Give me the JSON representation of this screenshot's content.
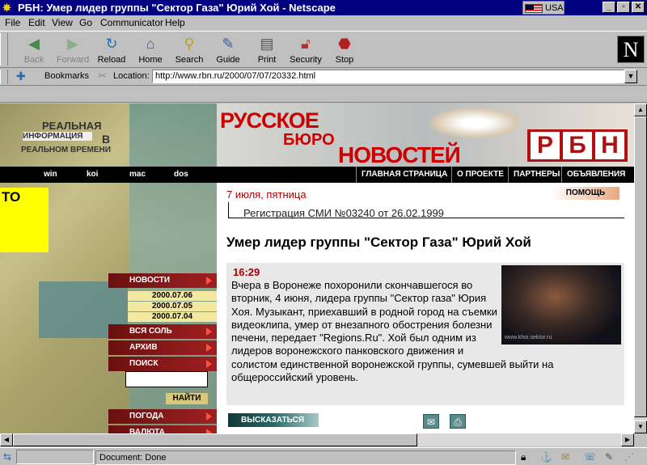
{
  "window": {
    "title": "РБН: Умер лидер группы \"Сектор Газа\" Юрий Хой - Netscape",
    "lang_indicator": "USA"
  },
  "menu": [
    "File",
    "Edit",
    "View",
    "Go",
    "Communicator",
    "Help"
  ],
  "toolbar": {
    "back": "Back",
    "forward": "Forward",
    "reload": "Reload",
    "home": "Home",
    "search": "Search",
    "guide": "Guide",
    "print": "Print",
    "security": "Security",
    "stop": "Stop"
  },
  "location": {
    "bookmarks_label": "Bookmarks",
    "location_label": "Location:",
    "url": "http://www.rbn.ru/2000/07/07/20332.html"
  },
  "site": {
    "realtime": {
      "line1": "РЕАЛЬНАЯ",
      "line2": "ИНФОРМАЦИЯ",
      "line3": "В",
      "line4": "РЕАЛЬНОМ ВРЕМЕНИ"
    },
    "encodings": [
      "win",
      "koi",
      "mac",
      "dos"
    ],
    "yellow_text": "ТО",
    "logo": {
      "line1": "РУССКОЕ",
      "line2": "БЮРО",
      "line3": "НОВОСТЕЙ",
      "letters": [
        "Р",
        "Б",
        "Н"
      ]
    },
    "nav": [
      "ГЛАВНАЯ СТРАНИЦА",
      "О ПРОЕКТЕ",
      "ПАРТНЕРЫ",
      "ОБЪЯВЛЕНИЯ"
    ],
    "date": "7 июля, пятница",
    "help": "ПОМОЩЬ",
    "registration": "Регистрация СМИ №03240 от 26.02.1999",
    "sidebar": {
      "news": "НОВОСТИ",
      "dates": [
        "2000.07.06",
        "2000.07.05",
        "2000.07.04"
      ],
      "all_salt": "ВСЯ СОЛЬ",
      "archive": "АРХИВ",
      "search": "ПОИСК",
      "find": "НАЙТИ",
      "weather": "ПОГОДА",
      "currency": "ВАЛЮТА"
    }
  },
  "article": {
    "headline": "Умер лидер группы \"Сектор Газа\" Юрий Хой",
    "time": "16:29",
    "lines": [
      "Вчера в Воронеже похоронили скончавшегося во",
      "вторник, 4 июня, лидера группы \"Сектор газа\" Юрия",
      "Хоя. Музыкант, приехавший в родной город на съемки",
      "видеоклипа, умер от внезапного обострения болезни",
      "печени, передает \"Regions.Ru\". Хой был одним из",
      "лидеров воронежского панковского движения и",
      "солистом единственной воронежской группы, сумевшей выйти на",
      "общероссийский уровень."
    ],
    "photo_caption": "www.khoi.sektor.ru",
    "comment": "ВЫСКАЗАТЬСЯ"
  },
  "status": {
    "text": "Document: Done"
  }
}
